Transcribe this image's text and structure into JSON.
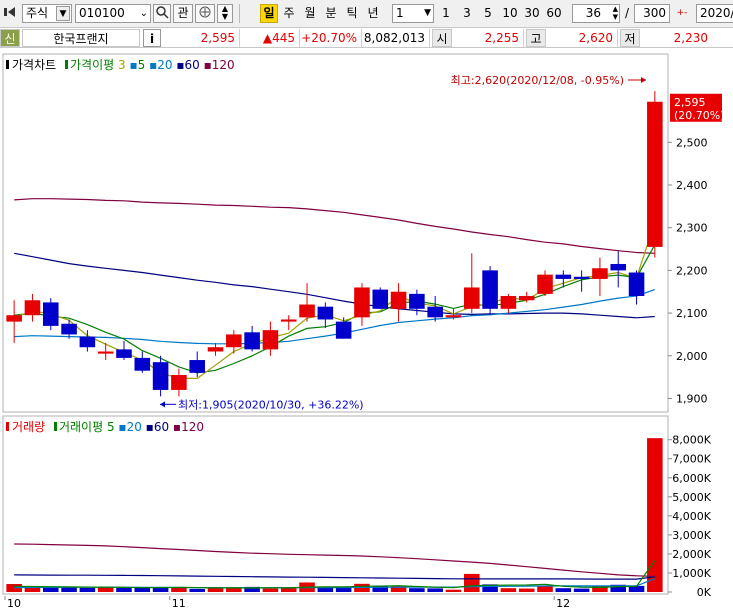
{
  "toolbar": {
    "market": "주식",
    "code": "010100",
    "favorite": "관",
    "periods": [
      "일",
      "주",
      "월",
      "분",
      "틱",
      "년"
    ],
    "active_period": "일",
    "interval_value": "1",
    "interval_shortcuts": [
      "1",
      "3",
      "5",
      "10",
      "30",
      "60"
    ],
    "count": "36",
    "total": "300",
    "date": "2020/"
  },
  "info": {
    "badge": "신",
    "name": "한국프랜지",
    "info_button": "i",
    "price": "2,595",
    "change": "▲445",
    "rate": "+20.70%",
    "volume": "8,082,013",
    "open_label": "시",
    "open": "2,255",
    "high_label": "고",
    "high": "2,620",
    "low_label": "저",
    "low": "2,230"
  },
  "price_pane": {
    "legend_title": "가격차트",
    "ma_title": "가격이평",
    "ma_periods": [
      "3",
      "5",
      "20",
      "60",
      "120"
    ],
    "y_ticks": [
      "2,500",
      "2,400",
      "2,300",
      "2,200",
      "2,100",
      "2,000",
      "1,900"
    ],
    "current_price_label": "2,595",
    "current_rate_label": "(20.70%)",
    "high_annotation": "최고:2,620(2020/12/08, -0.95%)",
    "low_annotation": "최저:1,905(2020/10/30, +36.22%)"
  },
  "volume_pane": {
    "legend_title": "거래량",
    "ma_title": "거래이평",
    "ma_periods": [
      "5",
      "20",
      "60",
      "120"
    ],
    "y_ticks": [
      "8,000K",
      "7,000K",
      "6,000K",
      "5,000K",
      "4,000K",
      "3,000K",
      "2,000K",
      "1,000K",
      "0K"
    ]
  },
  "x_axis": {
    "ticks": [
      "10",
      "11",
      "12"
    ]
  },
  "colors": {
    "up": "#e60000",
    "down": "#0000cc",
    "ma3": "#a0a000",
    "ma5": "#008000",
    "ma20": "#0078c8",
    "ma60": "#000080",
    "ma120": "#800040"
  },
  "chart_data": {
    "type": "candlestick",
    "y_range": [
      1880,
      2660
    ],
    "volume_range_k": [
      0,
      8300
    ],
    "candles": [
      {
        "o": 2080,
        "h": 2130,
        "l": 2030,
        "c": 2095,
        "v": 420
      },
      {
        "o": 2095,
        "h": 2145,
        "l": 2080,
        "c": 2130,
        "v": 300
      },
      {
        "o": 2125,
        "h": 2135,
        "l": 2060,
        "c": 2070,
        "v": 280
      },
      {
        "o": 2075,
        "h": 2085,
        "l": 2040,
        "c": 2050,
        "v": 260
      },
      {
        "o": 2045,
        "h": 2060,
        "l": 2010,
        "c": 2020,
        "v": 220
      },
      {
        "o": 2005,
        "h": 2030,
        "l": 1990,
        "c": 2010,
        "v": 260
      },
      {
        "o": 2015,
        "h": 2035,
        "l": 1990,
        "c": 1995,
        "v": 210
      },
      {
        "o": 1995,
        "h": 2010,
        "l": 1960,
        "c": 1965,
        "v": 230
      },
      {
        "o": 1985,
        "h": 2000,
        "l": 1905,
        "c": 1920,
        "v": 260
      },
      {
        "o": 1920,
        "h": 1970,
        "l": 1905,
        "c": 1955,
        "v": 240
      },
      {
        "o": 1990,
        "h": 2010,
        "l": 1950,
        "c": 1960,
        "v": 160
      },
      {
        "o": 2010,
        "h": 2030,
        "l": 2000,
        "c": 2020,
        "v": 200
      },
      {
        "o": 2020,
        "h": 2060,
        "l": 2005,
        "c": 2050,
        "v": 230
      },
      {
        "o": 2055,
        "h": 2070,
        "l": 2010,
        "c": 2015,
        "v": 270
      },
      {
        "o": 2015,
        "h": 2080,
        "l": 2000,
        "c": 2060,
        "v": 180
      },
      {
        "o": 2080,
        "h": 2095,
        "l": 2060,
        "c": 2085,
        "v": 200
      },
      {
        "o": 2090,
        "h": 2170,
        "l": 2080,
        "c": 2120,
        "v": 500
      },
      {
        "o": 2115,
        "h": 2125,
        "l": 2065,
        "c": 2085,
        "v": 260
      },
      {
        "o": 2080,
        "h": 2090,
        "l": 2040,
        "c": 2040,
        "v": 250
      },
      {
        "o": 2090,
        "h": 2170,
        "l": 2070,
        "c": 2160,
        "v": 430
      },
      {
        "o": 2155,
        "h": 2160,
        "l": 2110,
        "c": 2110,
        "v": 330
      },
      {
        "o": 2110,
        "h": 2170,
        "l": 2080,
        "c": 2150,
        "v": 310
      },
      {
        "o": 2145,
        "h": 2155,
        "l": 2095,
        "c": 2110,
        "v": 200
      },
      {
        "o": 2115,
        "h": 2140,
        "l": 2080,
        "c": 2090,
        "v": 190
      },
      {
        "o": 2090,
        "h": 2110,
        "l": 2085,
        "c": 2095,
        "v": 120
      },
      {
        "o": 2110,
        "h": 2240,
        "l": 2100,
        "c": 2160,
        "v": 950
      },
      {
        "o": 2200,
        "h": 2210,
        "l": 2095,
        "c": 2110,
        "v": 400
      },
      {
        "o": 2110,
        "h": 2145,
        "l": 2100,
        "c": 2140,
        "v": 200
      },
      {
        "o": 2130,
        "h": 2150,
        "l": 2125,
        "c": 2140,
        "v": 180
      },
      {
        "o": 2145,
        "h": 2200,
        "l": 2140,
        "c": 2190,
        "v": 320
      },
      {
        "o": 2190,
        "h": 2200,
        "l": 2160,
        "c": 2180,
        "v": 200
      },
      {
        "o": 2185,
        "h": 2200,
        "l": 2150,
        "c": 2180,
        "v": 180
      },
      {
        "o": 2180,
        "h": 2230,
        "l": 2140,
        "c": 2205,
        "v": 300
      },
      {
        "o": 2215,
        "h": 2245,
        "l": 2160,
        "c": 2200,
        "v": 380
      },
      {
        "o": 2195,
        "h": 2200,
        "l": 2120,
        "c": 2140,
        "v": 320
      },
      {
        "o": 2255,
        "h": 2620,
        "l": 2230,
        "c": 2595,
        "v": 8082
      }
    ],
    "ma3": [
      2090,
      2105,
      2098,
      2083,
      2047,
      2027,
      2008,
      1990,
      1960,
      1947,
      1947,
      1978,
      2010,
      2028,
      2042,
      2053,
      2088,
      2096,
      2082,
      2095,
      2105,
      2140,
      2123,
      2117,
      2098,
      2115,
      2122,
      2137,
      2130,
      2157,
      2170,
      2183,
      2188,
      2195,
      2182,
      2313
    ],
    "ma5": [
      2095,
      2100,
      2093,
      2088,
      2073,
      2055,
      2039,
      2012,
      1994,
      1974,
      1960,
      1966,
      1982,
      2000,
      2021,
      2046,
      2064,
      2068,
      2078,
      2100,
      2103,
      2123,
      2128,
      2121,
      2111,
      2121,
      2117,
      2123,
      2130,
      2144,
      2162,
      2178,
      2185,
      2189,
      2183,
      2260
    ],
    "ma20": [
      2045,
      2047,
      2046,
      2045,
      2044,
      2043,
      2041,
      2038,
      2034,
      2031,
      2029,
      2028,
      2028,
      2029,
      2031,
      2034,
      2040,
      2046,
      2053,
      2062,
      2071,
      2078,
      2082,
      2086,
      2089,
      2094,
      2096,
      2100,
      2104,
      2108,
      2114,
      2120,
      2128,
      2135,
      2140,
      2155
    ],
    "ma60": [
      2240,
      2232,
      2224,
      2216,
      2210,
      2205,
      2200,
      2195,
      2189,
      2183,
      2177,
      2172,
      2166,
      2162,
      2156,
      2150,
      2144,
      2136,
      2128,
      2121,
      2115,
      2110,
      2106,
      2102,
      2098,
      2097,
      2098,
      2098,
      2099,
      2100,
      2100,
      2098,
      2095,
      2092,
      2089,
      2092
    ],
    "ma120": [
      2365,
      2368,
      2368,
      2367,
      2366,
      2364,
      2363,
      2360,
      2358,
      2357,
      2355,
      2353,
      2352,
      2350,
      2348,
      2347,
      2344,
      2340,
      2336,
      2330,
      2324,
      2318,
      2310,
      2303,
      2297,
      2290,
      2284,
      2279,
      2272,
      2266,
      2262,
      2256,
      2251,
      2246,
      2242,
      2240
    ],
    "vma5": [
      300,
      290,
      280,
      270,
      260,
      250,
      240,
      230,
      230,
      240,
      230,
      220,
      215,
      210,
      220,
      215,
      260,
      270,
      270,
      300,
      310,
      330,
      290,
      260,
      230,
      330,
      350,
      360,
      370,
      400,
      300,
      260,
      240,
      280,
      300,
      1650
    ],
    "vma20": [
      230,
      235,
      240,
      245,
      250,
      255,
      250,
      245,
      240,
      235,
      230,
      228,
      226,
      225,
      225,
      226,
      228,
      230,
      234,
      240,
      246,
      252,
      256,
      258,
      260,
      280,
      295,
      300,
      305,
      315,
      320,
      320,
      318,
      320,
      322,
      700
    ],
    "vma60": [
      900,
      895,
      890,
      885,
      880,
      875,
      870,
      865,
      855,
      845,
      835,
      825,
      815,
      805,
      795,
      785,
      775,
      765,
      755,
      745,
      735,
      725,
      715,
      705,
      695,
      690,
      690,
      690,
      690,
      690,
      690,
      685,
      680,
      680,
      680,
      800
    ],
    "vma120": [
      2520,
      2510,
      2490,
      2470,
      2450,
      2420,
      2380,
      2330,
      2280,
      2230,
      2180,
      2130,
      2080,
      2040,
      2010,
      1980,
      1960,
      1940,
      1920,
      1890,
      1850,
      1800,
      1750,
      1690,
      1630,
      1570,
      1500,
      1420,
      1330,
      1240,
      1150,
      1060,
      980,
      900,
      850,
      820
    ]
  }
}
